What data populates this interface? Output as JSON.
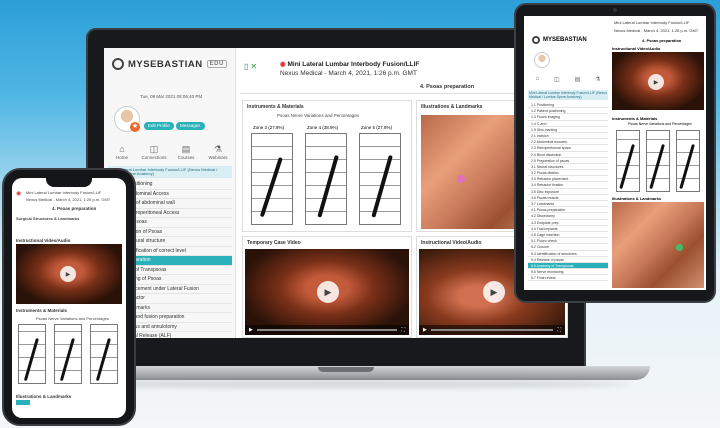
{
  "app": {
    "logo_text": "MYSEBASTIAN",
    "logo_sub": "EDU",
    "date": "Tue, 09 Mar 2021 06:06:40 PM",
    "profile_btn": "Edit Profile",
    "messages_btn": "Messages",
    "nav": [
      {
        "label": "Home",
        "icon": "⌂"
      },
      {
        "label": "Connections",
        "icon": "◫"
      },
      {
        "label": "Courses",
        "icon": "▤"
      },
      {
        "label": "Webinars",
        "icon": "⚗"
      }
    ],
    "procedure_header": "Mini Lateral Lumbar Interbody Fusion/LLIF (Nexus Medical / Lumbar Spine Anatomy)",
    "steps": [
      "Positioning",
      "Abdominal Access",
      "ing of abdominal wall",
      "Retroperitoneal Access",
      "of psoas",
      "sation of Psoas",
      "l neural structure",
      "entification of correct level",
      "reparation",
      "on of Transpsoas",
      "arting of Psoas",
      "Placement under Lateral Fusion",
      "ntractor",
      "andmarks",
      "ny and fusion preparation",
      "ectus and annulotomy",
      "teral Release (ALF)"
    ],
    "active_step_index": 8,
    "title": "Mini Lateral Lumbar Interbody Fusion/LLIF",
    "subtitle": "Nexus Medical - March 4, 2021, 1:26 p.m. GMT",
    "section": "4. Psoas preparation",
    "cards": {
      "instruments": "Instruments & Materials",
      "illustrations": "Illustrations & Landmarks",
      "temporary_video": "Temporary Case Video",
      "instructional": "Instructional Video/Audio"
    },
    "spine_caption": "Psoas Nerve Variations and Percentages",
    "zones": [
      "Zone 3 (27.8%)",
      "Zone 4 (38.9%)",
      "Zone 5 (27.8%)"
    ],
    "badge": "Zones"
  },
  "tablet": {
    "section": "4. Psoas preparation",
    "instructional": "Instructional Video/Audio",
    "instruments": "Instruments & Materials",
    "illustrations": "Illustrations & Landmarks",
    "steps": [
      "1.1 Positioning",
      "1.2 Patient positioning",
      "1.3 Fluoro imaging",
      "1.4 C-arm",
      "1.5 Skin marking",
      "2.1 Incision",
      "2.2 Abdominal muscles",
      "2.3 Retroperitoneal space",
      "2.4 Blunt dissection",
      "2.5 Preparation of psoas",
      "3.1 Neural structures",
      "3.2 Psoas dilation",
      "3.3 Retractor placement",
      "3.4 Retractor fixation",
      "3.5 Disc exposure",
      "3.6 Psoas muscle",
      "3.7 Landmarks",
      "4.1 Psoas preparation",
      "4.2 Discectomy",
      "4.3 Endplate prep",
      "4.4 Trial implants",
      "4.5 Cage insertion",
      "5.1 Fluoro check",
      "5.2 Closure",
      "5.3 Identification of structures",
      "5.4 Release of psoas",
      "5.5 Anatomy of Transpsoas",
      "5.6 Nerve monitoring",
      "5.7 Final review"
    ],
    "active_step_index": 26
  },
  "phone": {
    "title": "Mini Lateral Lumbar Interbody Fusion/LLIF",
    "subtitle": "Nexus Medical - March 4, 2021, 1:26 p.m. GMT",
    "section": "4. Psoas preparation",
    "sub_heading": "Surgical Structures & Landmarks",
    "instructional": "Instructional Video/Audio",
    "instruments": "Instruments & Materials",
    "spine_caption": "Psoas Nerve Variations and Percentages",
    "illustrations": "Illustrations & Landmarks"
  }
}
